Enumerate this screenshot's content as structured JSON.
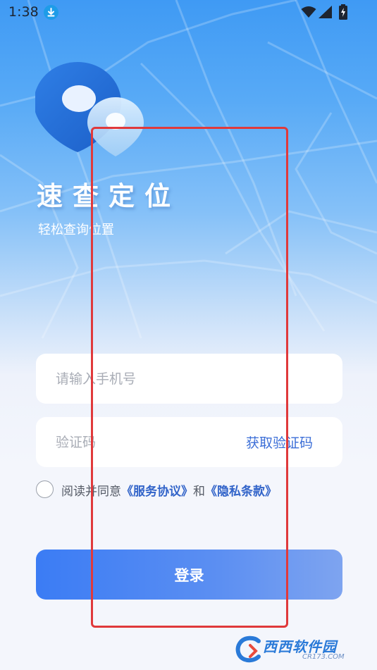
{
  "status_bar": {
    "time": "1:38",
    "icons": [
      "download-icon",
      "wifi-icon",
      "signal-icon",
      "battery-charging-icon"
    ]
  },
  "app": {
    "title": "速查定位",
    "subtitle": "轻松查询位置"
  },
  "form": {
    "phone_placeholder": "请输入手机号",
    "code_placeholder": "验证码",
    "get_code_label": "获取验证码",
    "agree_prefix": "阅读并同意",
    "service_link": "《服务协议》",
    "and_text": "和",
    "privacy_link": "《隐私条款》",
    "agreed": false,
    "login_label": "登录"
  },
  "watermark": {
    "text": "西西软件园",
    "sub": "CR173.COM"
  },
  "colors": {
    "primary": "#3b7cf4",
    "link": "#3264c9",
    "highlight": "#e0393b"
  }
}
